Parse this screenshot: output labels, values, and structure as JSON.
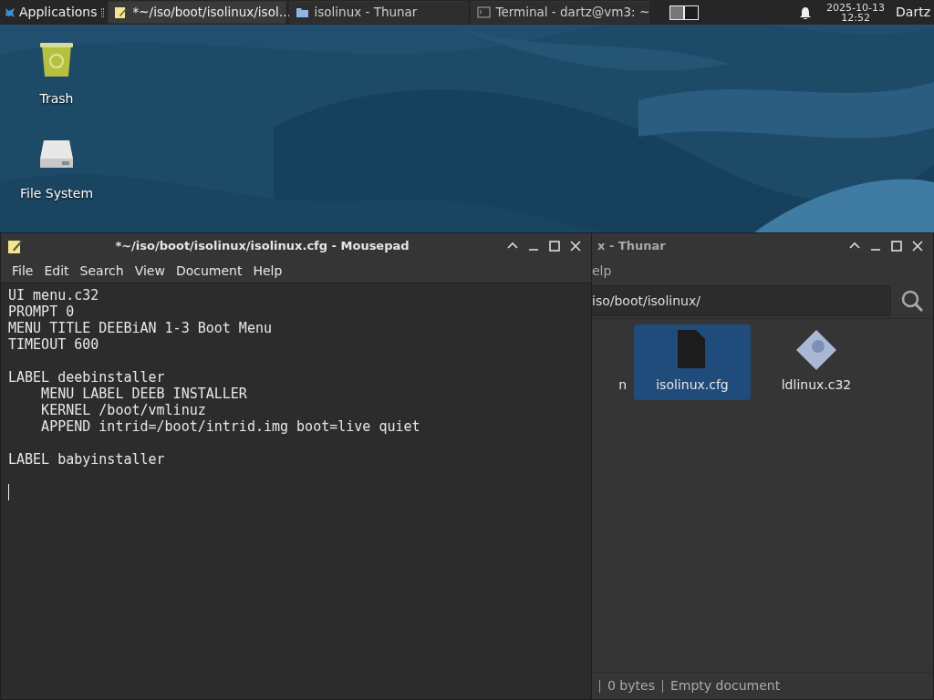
{
  "panel": {
    "menu_label": "Applications",
    "tasks": [
      {
        "label": "*~/iso/boot/isolinux/isol…",
        "kind": "editor",
        "selected": true
      },
      {
        "label": "isolinux - Thunar",
        "kind": "folder",
        "selected": false
      },
      {
        "label": "Terminal - dartz@vm3: ~",
        "kind": "terminal",
        "selected": false
      }
    ],
    "workspaces": [
      {
        "selected": true
      },
      {
        "selected": false
      }
    ],
    "clock": {
      "date": "2025-10-13",
      "time": "12:52"
    },
    "user": "Dartz"
  },
  "desktop_icons": [
    {
      "label": "Trash",
      "kind": "trash"
    },
    {
      "label": "File System",
      "kind": "drive"
    }
  ],
  "file_manager": {
    "title": "x - Thunar",
    "menu": [
      "elp"
    ],
    "path": "iso/boot/isolinux/",
    "files": [
      {
        "label": "n",
        "kind": "partial",
        "selected": false
      },
      {
        "label": "isolinux.cfg",
        "kind": "document",
        "selected": true
      },
      {
        "label": "ldlinux.c32",
        "kind": "binary",
        "selected": false
      }
    ],
    "status": [
      "0 bytes",
      "Empty document"
    ]
  },
  "editor": {
    "title": "*~/iso/boot/isolinux/isolinux.cfg - Mousepad",
    "menu": [
      "File",
      "Edit",
      "Search",
      "View",
      "Document",
      "Help"
    ],
    "cursor": true,
    "blocks": [
      {
        "lines": [
          {
            "text": "UI menu.c32"
          },
          {
            "text": "PROMPT 0"
          },
          {
            "text": "MENU TITLE DEEBiAN 1-3 Boot Menu"
          },
          {
            "text": "TIMEOUT 600"
          }
        ]
      },
      {
        "lines": [
          {
            "text": "LABEL deebinstaller",
            "children": [
              {
                "text": "MENU LABEL DEEB INSTALLER"
              },
              {
                "text": "KERNEL /boot/vmlinuz"
              },
              {
                "text": "APPEND intrid=/boot/intrid.img boot=live quiet"
              }
            ]
          }
        ]
      },
      {
        "lines": [
          {
            "text": "LABEL babyinstaller"
          }
        ]
      }
    ]
  }
}
